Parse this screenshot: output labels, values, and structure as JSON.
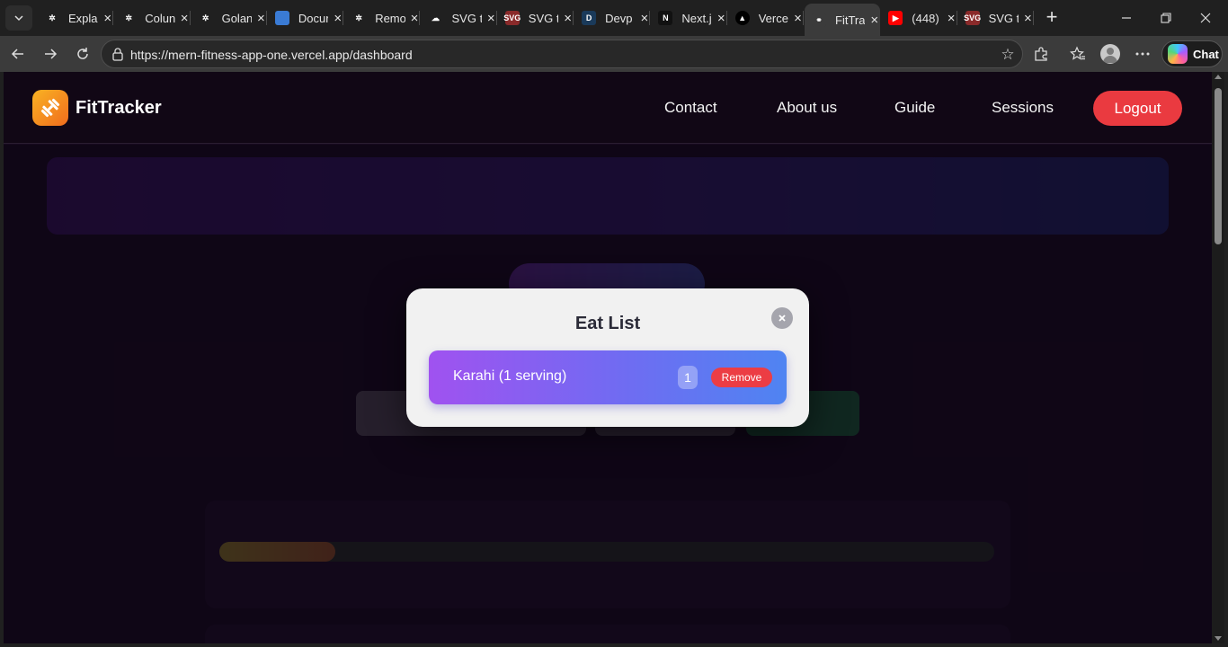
{
  "browser": {
    "tabs": [
      {
        "label": "Explai",
        "icon": "openai-icon",
        "fav_color": "#202020",
        "fav_text": ""
      },
      {
        "label": "Colun",
        "icon": "openai-icon",
        "fav_color": "#202020",
        "fav_text": ""
      },
      {
        "label": "Golan",
        "icon": "openai-icon",
        "fav_color": "#202020",
        "fav_text": ""
      },
      {
        "label": "Docur",
        "icon": "document-app-icon",
        "fav_color": "#3a7bd5",
        "fav_text": ""
      },
      {
        "label": "Remo",
        "icon": "openai-icon",
        "fav_color": "#202020",
        "fav_text": ""
      },
      {
        "label": "SVG t",
        "icon": "cloud-icon",
        "fav_color": "#202020",
        "fav_text": ""
      },
      {
        "label": "SVG t",
        "icon": "svg-jpg-icon",
        "fav_color": "#8a2a2a",
        "fav_text": "SVG"
      },
      {
        "label": "Devp",
        "icon": "devpost-icon",
        "fav_color": "#1a3a5a",
        "fav_text": "D"
      },
      {
        "label": "Next.j",
        "icon": "nextjs-icon",
        "fav_color": "#111111",
        "fav_text": "N"
      },
      {
        "label": "Verce",
        "icon": "vercel-icon",
        "fav_color": "#ffffff",
        "fav_text": ""
      },
      {
        "label": "FitTra",
        "icon": "fittracker-icon",
        "fav_color": "#3b3b3b",
        "fav_text": "",
        "active": true
      },
      {
        "label": "(448)",
        "icon": "youtube-icon",
        "fav_color": "#ff0000",
        "fav_text": ""
      },
      {
        "label": "SVG t",
        "icon": "svg-png-icon",
        "fav_color": "#8a2a2a",
        "fav_text": "SVG"
      }
    ],
    "url": "https://mern-fitness-app-one.vercel.app/dashboard",
    "chat_label": "Chat"
  },
  "nav": {
    "brand": "FitTracker",
    "links": [
      "Contact",
      "About us",
      "Guide",
      "Sessions"
    ],
    "logout": "Logout"
  },
  "modal": {
    "title": "Eat List",
    "items": [
      {
        "name": "Karahi (1 serving)",
        "qty": "1",
        "remove_label": "Remove"
      }
    ]
  },
  "background": {
    "calories_progress": 0.15
  },
  "colors": {
    "accent_logout": "#ea3a40",
    "brand_logo": "#f9b323",
    "item_gradient_start": "#a052f0",
    "item_gradient_end": "#4f84f2"
  }
}
